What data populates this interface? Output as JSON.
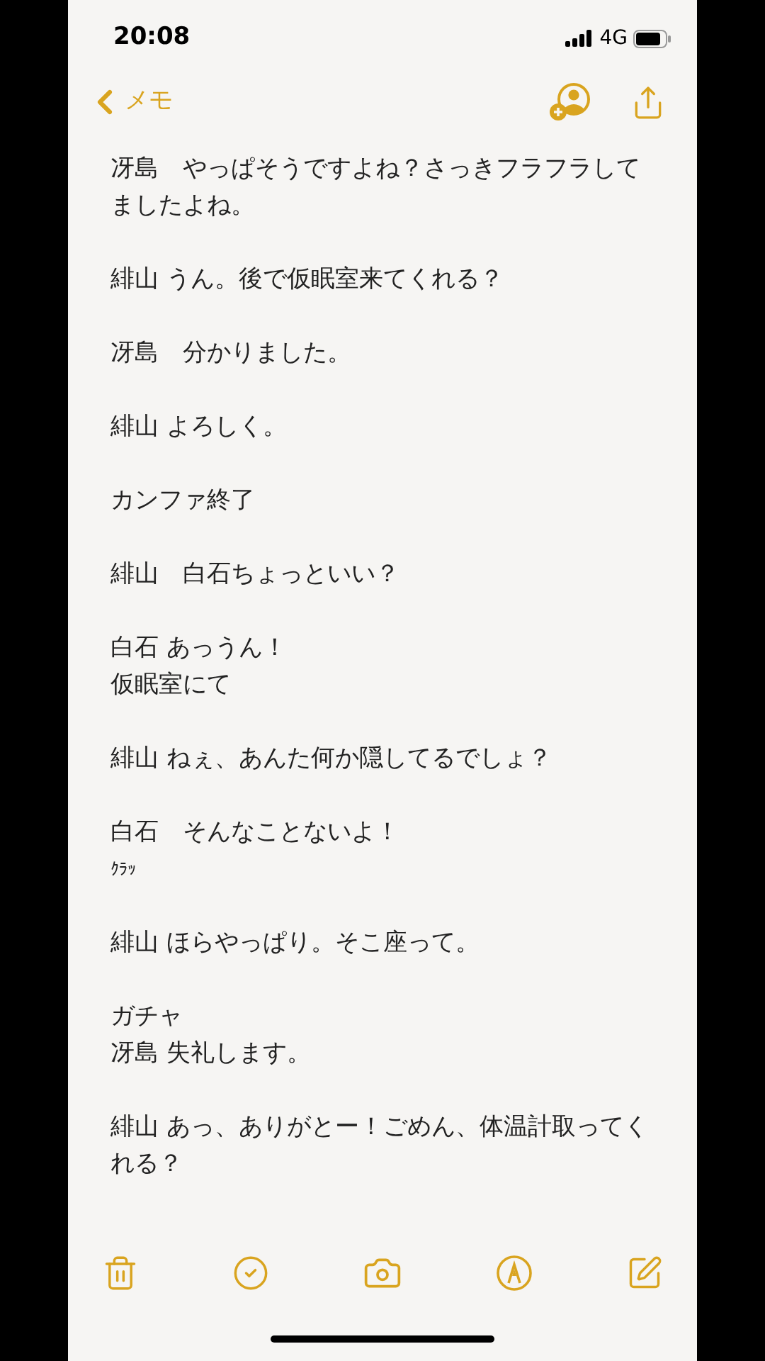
{
  "status_bar": {
    "time": "20:08",
    "network": "4G"
  },
  "nav": {
    "back_label": "メモ"
  },
  "note": {
    "paragraphs": [
      {
        "lines": [
          {
            "text": "冴島　やっぱそうですよね？さっきフラフラして",
            "kind": "body"
          },
          {
            "text": "ましたよね。",
            "kind": "body"
          }
        ]
      },
      {
        "lines": [
          {
            "text": "緋山 うん。後で仮眠室来てくれる？",
            "kind": "body"
          }
        ]
      },
      {
        "lines": [
          {
            "text": "冴島　分かりました。",
            "kind": "body"
          }
        ]
      },
      {
        "lines": [
          {
            "text": "緋山 よろしく。",
            "kind": "body"
          }
        ]
      },
      {
        "lines": [
          {
            "text": "カンファ終了",
            "kind": "body"
          }
        ]
      },
      {
        "lines": [
          {
            "text": "緋山　白石ちょっといい？",
            "kind": "body"
          }
        ]
      },
      {
        "lines": [
          {
            "text": "白石 あっうん！",
            "kind": "body"
          },
          {
            "text": "仮眠室にて",
            "kind": "body"
          }
        ]
      },
      {
        "lines": [
          {
            "text": "緋山 ねぇ、あんた何か隠してるでしょ？",
            "kind": "body"
          }
        ]
      },
      {
        "lines": [
          {
            "text": "白石　そんなことないよ！",
            "kind": "body"
          },
          {
            "text": "ｸﾗｯ",
            "kind": "aside"
          }
        ]
      },
      {
        "lines": [
          {
            "text": "緋山 ほらやっぱり。そこ座って。",
            "kind": "body"
          }
        ]
      },
      {
        "lines": [
          {
            "text": "ガチャ",
            "kind": "body"
          },
          {
            "text": "冴島 失礼します。",
            "kind": "body"
          }
        ]
      },
      {
        "lines": [
          {
            "text": "緋山 あっ、ありがとー！ごめん、体温計取ってく",
            "kind": "body"
          },
          {
            "text": "れる？",
            "kind": "body"
          }
        ]
      }
    ]
  }
}
